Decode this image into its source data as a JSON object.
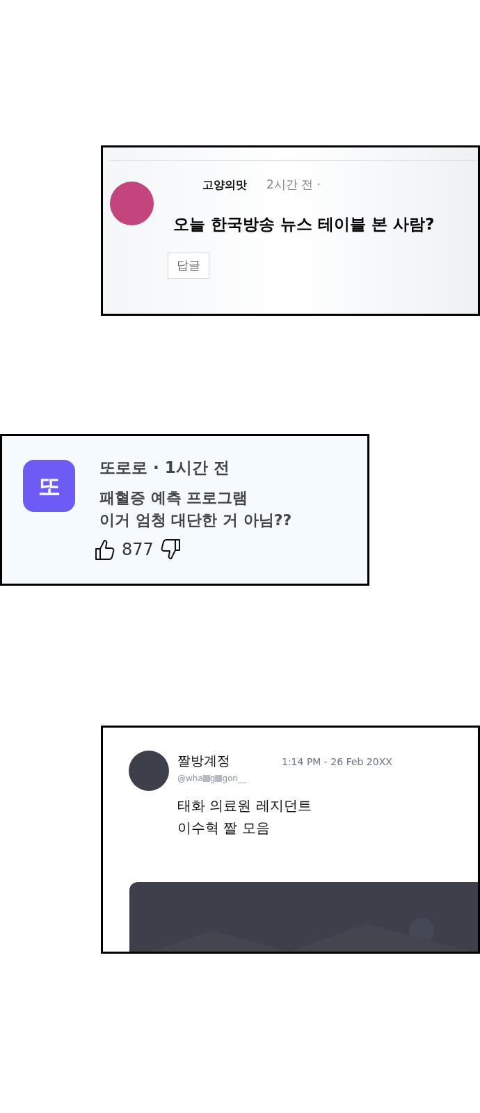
{
  "comment_card": {
    "author": "고양의맛",
    "time": "2시간 전 ·",
    "text": "오늘 한국방송 뉴스 테이블 본 사람?",
    "reply_button": "답글"
  },
  "post_card": {
    "app_icon": "또",
    "header": "또로로 · 1시간 전",
    "lines": [
      "패혈증 예측 프로그램",
      "이거 엄청 대단한 거 아님??"
    ],
    "likes": "877"
  },
  "tweet_card": {
    "name": "짤방계정",
    "time": "1:14 PM - 26 Feb 20XX",
    "handle_parts": [
      {
        "kind": "text",
        "text": "@wha"
      },
      {
        "kind": "redacted"
      },
      {
        "kind": "text",
        "text": "g"
      },
      {
        "kind": "redacted"
      },
      {
        "kind": "text",
        "text": "gon__"
      }
    ],
    "lines": [
      "태화 의료원 레지던트",
      "이수혁 짤 모음"
    ]
  }
}
